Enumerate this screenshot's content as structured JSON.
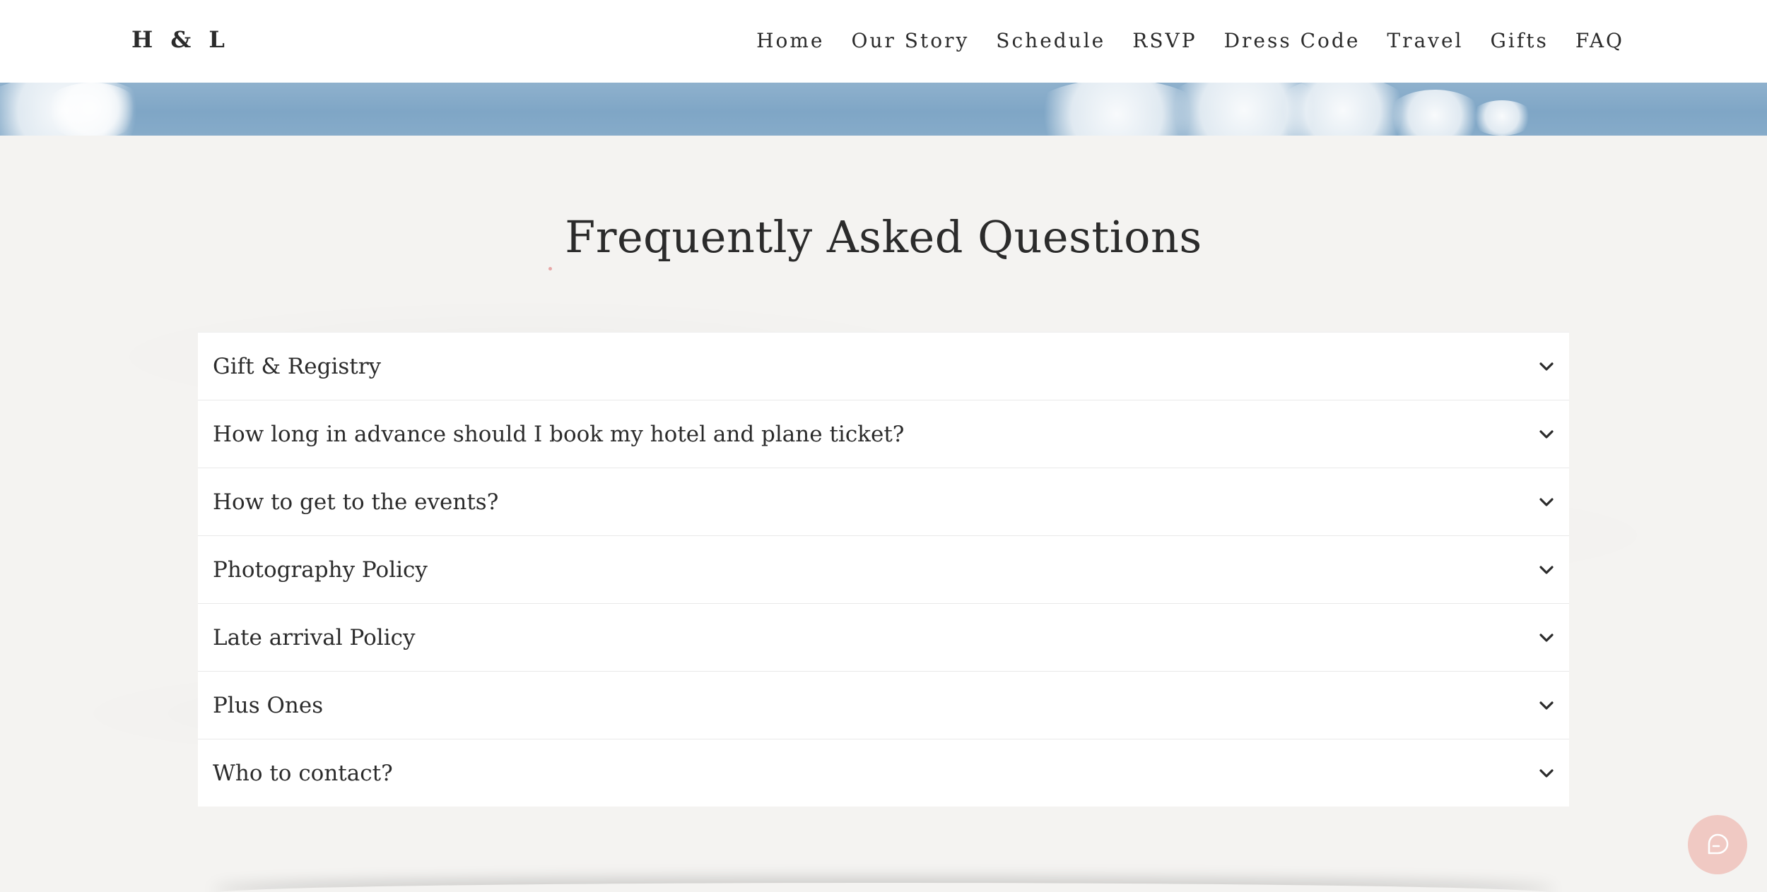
{
  "header": {
    "logo": "H & L",
    "nav": [
      "Home",
      "Our Story",
      "Schedule",
      "RSVP",
      "Dress Code",
      "Travel",
      "Gifts",
      "FAQ"
    ]
  },
  "faq": {
    "title": "Frequently Asked Questions",
    "items": [
      "Gift & Registry",
      "How long in advance should I book my hotel and plane ticket?",
      "How to get to the events?",
      "Photography Policy",
      "Late arrival Policy",
      "Plus Ones",
      "Who to contact?"
    ]
  },
  "icons": {
    "accordion": "chevron-down-icon",
    "chat": "chat-bubble-icon"
  },
  "colors": {
    "page_background": "#f4f3f1",
    "header_background": "#ffffff",
    "text": "#2b2b2b",
    "sky": "#7fa6c6",
    "chat_button": "#f0c9c3"
  }
}
